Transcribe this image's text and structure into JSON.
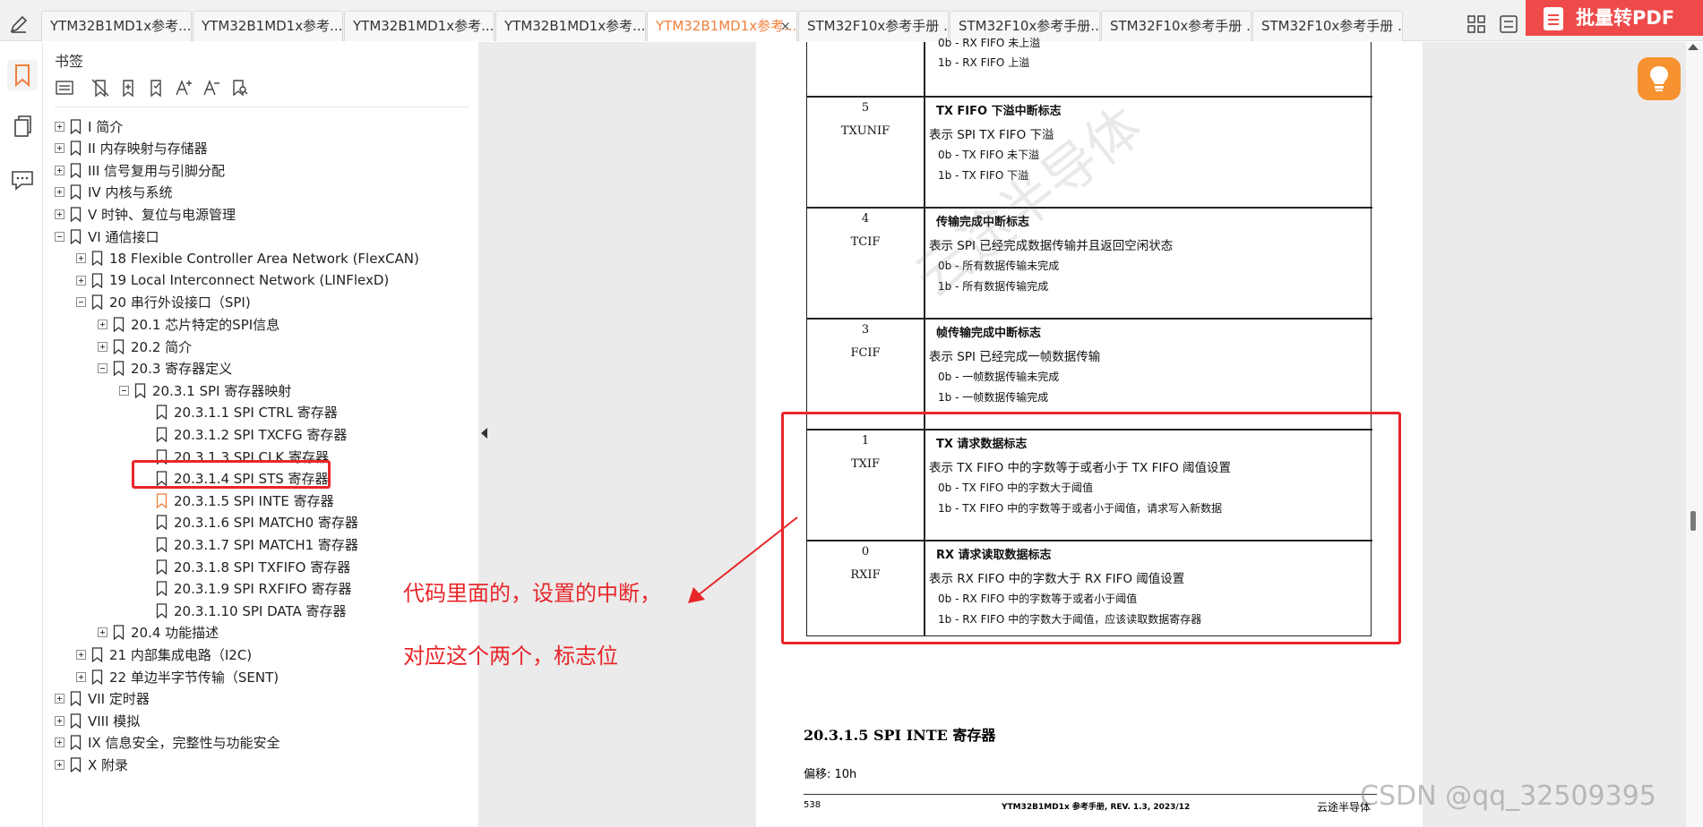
{
  "tabs": [
    {
      "label": "YTM32B1MD1x参考..."
    },
    {
      "label": "YTM32B1MD1x参考..."
    },
    {
      "label": "YTM32B1MD1x参考..."
    },
    {
      "label": "YTM32B1MD1x参考..."
    },
    {
      "label": "YTM32B1MD1x参考...",
      "active": true
    },
    {
      "label": "STM32F10x参考手册 ..."
    },
    {
      "label": "STM32F10x参考手册..."
    },
    {
      "label": "STM32F10x参考手册 ..."
    },
    {
      "label": "STM32F10x参考手册 ..."
    }
  ],
  "tab_close": "×",
  "batch_pdf_label": "批量转PDF",
  "bookmarks_title": "书签",
  "tree": [
    {
      "label": "I  简介",
      "level": 0,
      "exp": "plus"
    },
    {
      "label": "II  内存映射与存储器",
      "level": 0,
      "exp": "plus"
    },
    {
      "label": "III  信号复用与引脚分配",
      "level": 0,
      "exp": "plus"
    },
    {
      "label": "IV  内核与系统",
      "level": 0,
      "exp": "plus"
    },
    {
      "label": "V  时钟、复位与电源管理",
      "level": 0,
      "exp": "plus"
    },
    {
      "label": "VI  通信接口",
      "level": 0,
      "exp": "minus"
    },
    {
      "label": "18 Flexible Controller Area Network (FlexCAN)",
      "level": 1,
      "exp": "plus"
    },
    {
      "label": "19 Local Interconnect Network (LINFlexD)",
      "level": 1,
      "exp": "plus"
    },
    {
      "label": "20 串行外设接口（SPI)",
      "level": 1,
      "exp": "minus"
    },
    {
      "label": "20.1 芯片特定的SPI信息",
      "level": 2,
      "exp": "plus"
    },
    {
      "label": "20.2 简介",
      "level": 2,
      "exp": "plus"
    },
    {
      "label": "20.3 寄存器定义",
      "level": 2,
      "exp": "minus"
    },
    {
      "label": "20.3.1 SPI 寄存器映射",
      "level": 3,
      "exp": "minus"
    },
    {
      "label": "20.3.1.1  SPI CTRL 寄存器",
      "level": 4,
      "exp": "none"
    },
    {
      "label": "20.3.1.2  SPI TXCFG 寄存器",
      "level": 4,
      "exp": "none"
    },
    {
      "label": "20.3.1.3  SPI CLK 寄存器",
      "level": 4,
      "exp": "none"
    },
    {
      "label": "20.3.1.4  SPI STS 寄存器",
      "level": 4,
      "exp": "none",
      "highlight": true
    },
    {
      "label": "20.3.1.5  SPI INTE 寄存器",
      "level": 4,
      "exp": "none",
      "orange": true
    },
    {
      "label": "20.3.1.6  SPI MATCH0 寄存器",
      "level": 4,
      "exp": "none"
    },
    {
      "label": "20.3.1.7  SPI MATCH1 寄存器",
      "level": 4,
      "exp": "none"
    },
    {
      "label": "20.3.1.8  SPI TXFIFO 寄存器",
      "level": 4,
      "exp": "none"
    },
    {
      "label": "20.3.1.9  SPI RXFIFO 寄存器",
      "level": 4,
      "exp": "none"
    },
    {
      "label": "20.3.1.10  SPI DATA 寄存器",
      "level": 4,
      "exp": "none"
    },
    {
      "label": "20.4 功能描述",
      "level": 2,
      "exp": "plus"
    },
    {
      "label": "21 内部集成电路（I2C)",
      "level": 1,
      "exp": "plus"
    },
    {
      "label": "22 单边半字节传输（SENT)",
      "level": 1,
      "exp": "plus"
    },
    {
      "label": "VII  定时器",
      "level": 0,
      "exp": "plus"
    },
    {
      "label": "VIII  模拟",
      "level": 0,
      "exp": "plus"
    },
    {
      "label": "IX  信息安全，完整性与功能安全",
      "level": 0,
      "exp": "plus"
    },
    {
      "label": "X  附录",
      "level": 0,
      "exp": "plus"
    }
  ],
  "doc": {
    "top_options": [
      "0b - RX FIFO 未上溢",
      "1b - RX FIFO 上溢"
    ],
    "fields": [
      {
        "bit": "5",
        "name": "TXUNIF",
        "title": "TX FIFO 下溢中断标志",
        "desc": "表示 SPI TX FIFO 下溢",
        "opts": [
          "0b - TX FIFO 未下溢",
          "1b - TX FIFO 下溢"
        ]
      },
      {
        "bit": "4",
        "name": "TCIF",
        "title": "传输完成中断标志",
        "desc": "表示 SPI 已经完成数据传输并且返回空闲状态",
        "opts": [
          "0b - 所有数据传输未完成",
          "1b - 所有数据传输完成"
        ]
      },
      {
        "bit": "3",
        "name": "FCIF",
        "title": "帧传输完成中断标志",
        "desc": "表示 SPI 已经完成一帧数据传输",
        "opts": [
          "0b - 一帧数据传输未完成",
          "1b - 一帧数据传输完成"
        ]
      },
      {
        "bit": "1",
        "name": "TXIF",
        "title": "TX 请求数据标志",
        "desc": "表示 TX FIFO 中的字数等于或者小于 TX FIFO 阈值设置",
        "opts": [
          "0b - TX FIFO 中的字数大于阈值",
          "1b - TX FIFO 中的字数等于或者小于阈值，请求写入新数据"
        ]
      },
      {
        "bit": "0",
        "name": "RXIF",
        "title": "RX 请求读取数据标志",
        "desc": "表示 RX FIFO 中的字数大于 RX FIFO 阈值设置",
        "opts": [
          "0b - RX FIFO 中的字数等于或者小于阈值",
          "1b - RX FIFO 中的字数大于阈值，应该读取数据寄存器"
        ]
      }
    ],
    "section_heading": "20.3.1.5     SPI INTE 寄存器",
    "offset": "偏移: 10h",
    "footer_page": "538",
    "footer_title": "YTM32B1MD1x 参考手册, REV. 1.3, 2023/12",
    "footer_brand": "云途半导体",
    "watermark": "云途半导体"
  },
  "annotation": {
    "line1": "代码里面的，设置的中断，",
    "line2": "对应这个两个，标志位"
  },
  "csdn_watermark": "CSDN @qq_32509395",
  "colors": {
    "accent_orange": "#f07f3c",
    "highlight_red": "#e8262a",
    "batch_red": "#ee4a4a",
    "bulb_orange": "#f6922f"
  },
  "icons": [
    "pen-icon",
    "grid-icon",
    "list-icon",
    "bookmark-icon",
    "pages-icon",
    "comment-icon",
    "lightbulb-icon"
  ]
}
